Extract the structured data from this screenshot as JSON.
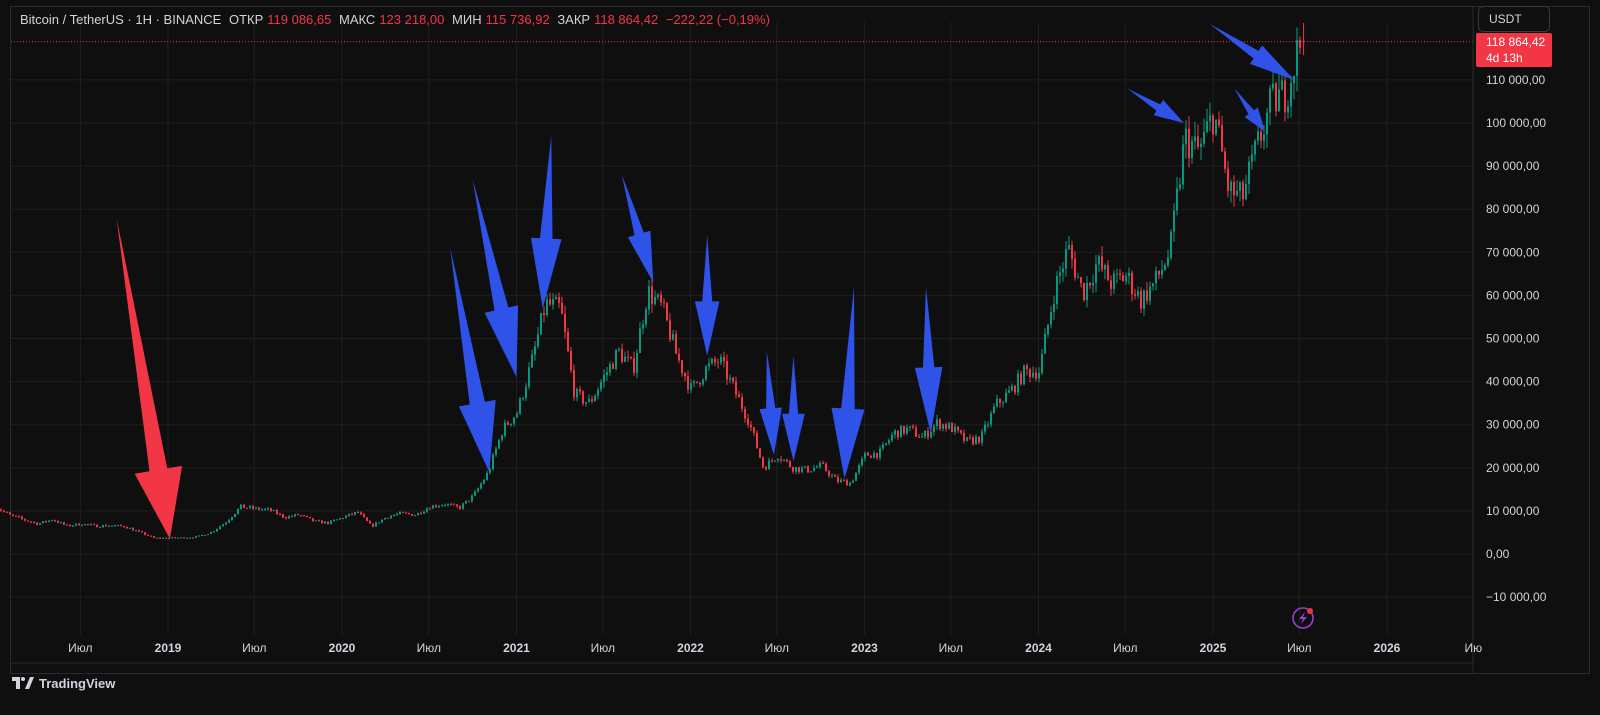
{
  "legend": {
    "symbol": "Bitcoin / TetherUS · 1H · BINANCE",
    "open_label": "ОТКР",
    "open_value": "119 086,65",
    "high_label": "МАКС",
    "high_value": "123 218,00",
    "low_label": "МИН",
    "low_value": "115 736,92",
    "close_label": "ЗАКР",
    "close_value": "118 864,42",
    "change": "−222,22 (−0,19%)"
  },
  "currency_button": "USDT",
  "price_tag": {
    "price": "118 864,42",
    "countdown": "4d 13h"
  },
  "branding": "TradingView",
  "colors": {
    "up": "#089981",
    "down": "#f23645",
    "blue_arrow": "#2f52e8",
    "red_arrow": "#f23645",
    "background": "#0f0f0f",
    "grid": "#1f1f1f"
  },
  "chart_data": {
    "type": "candlestick",
    "y_scale": "linear",
    "ylim": [
      -15000,
      128000
    ],
    "xlim": [
      "2018-01-01",
      "2026-07-31"
    ],
    "y_ticks": [
      {
        "value": -10000,
        "label": "−10 000,00"
      },
      {
        "value": 0,
        "label": "0,00"
      },
      {
        "value": 10000,
        "label": "10 000,00"
      },
      {
        "value": 20000,
        "label": "20 000,00"
      },
      {
        "value": 30000,
        "label": "30 000,00"
      },
      {
        "value": 40000,
        "label": "40 000,00"
      },
      {
        "value": 50000,
        "label": "50 000,00"
      },
      {
        "value": 60000,
        "label": "60 000,00"
      },
      {
        "value": 70000,
        "label": "70 000,00"
      },
      {
        "value": 80000,
        "label": "80 000,00"
      },
      {
        "value": 90000,
        "label": "90 000,00"
      },
      {
        "value": 100000,
        "label": "100 000,00"
      },
      {
        "value": 110000,
        "label": "110 000,00"
      }
    ],
    "x_ticks": [
      {
        "date": "2018-07-01",
        "label": "Июл",
        "bold": false
      },
      {
        "date": "2019-01-01",
        "label": "2019",
        "bold": true
      },
      {
        "date": "2019-07-01",
        "label": "Июл",
        "bold": false
      },
      {
        "date": "2020-01-01",
        "label": "2020",
        "bold": true
      },
      {
        "date": "2020-07-01",
        "label": "Июл",
        "bold": false
      },
      {
        "date": "2021-01-01",
        "label": "2021",
        "bold": true
      },
      {
        "date": "2021-07-01",
        "label": "Июл",
        "bold": false
      },
      {
        "date": "2022-01-01",
        "label": "2022",
        "bold": true
      },
      {
        "date": "2022-07-01",
        "label": "Июл",
        "bold": false
      },
      {
        "date": "2023-01-01",
        "label": "2023",
        "bold": true
      },
      {
        "date": "2023-07-01",
        "label": "Июл",
        "bold": false
      },
      {
        "date": "2024-01-01",
        "label": "2024",
        "bold": true
      },
      {
        "date": "2024-07-01",
        "label": "Июл",
        "bold": false
      },
      {
        "date": "2025-01-01",
        "label": "2025",
        "bold": true
      },
      {
        "date": "2025-07-01",
        "label": "Июл",
        "bold": false
      },
      {
        "date": "2026-01-01",
        "label": "2026",
        "bold": true
      },
      {
        "date": "2026-07-01",
        "label": "Ию",
        "bold": false
      }
    ],
    "last_price": 118864.42,
    "price_series": {
      "name": "BTCUSDT",
      "points": [
        [
          "2018-01-01",
          11000
        ],
        [
          "2018-02-01",
          9000
        ],
        [
          "2018-03-01",
          8000
        ],
        [
          "2018-04-01",
          7000
        ],
        [
          "2018-05-01",
          8000
        ],
        [
          "2018-06-01",
          6500
        ],
        [
          "2018-07-01",
          7000
        ],
        [
          "2018-08-01",
          6500
        ],
        [
          "2018-09-01",
          6600
        ],
        [
          "2018-10-01",
          6400
        ],
        [
          "2018-11-01",
          5000
        ],
        [
          "2018-12-01",
          3700
        ],
        [
          "2019-01-01",
          3700
        ],
        [
          "2019-02-01",
          3800
        ],
        [
          "2019-03-01",
          4000
        ],
        [
          "2019-04-01",
          5100
        ],
        [
          "2019-05-01",
          7500
        ],
        [
          "2019-06-01",
          11000
        ],
        [
          "2019-07-01",
          10500
        ],
        [
          "2019-08-01",
          10200
        ],
        [
          "2019-09-01",
          8500
        ],
        [
          "2019-10-01",
          9100
        ],
        [
          "2019-11-01",
          7600
        ],
        [
          "2019-12-01",
          7200
        ],
        [
          "2020-01-01",
          8500
        ],
        [
          "2020-02-01",
          9700
        ],
        [
          "2020-03-01",
          6400
        ],
        [
          "2020-04-01",
          8600
        ],
        [
          "2020-05-01",
          9400
        ],
        [
          "2020-06-01",
          9100
        ],
        [
          "2020-07-01",
          11000
        ],
        [
          "2020-08-01",
          11600
        ],
        [
          "2020-09-01",
          10700
        ],
        [
          "2020-10-01",
          13500
        ],
        [
          "2020-11-01",
          19000
        ],
        [
          "2020-12-01",
          28900
        ],
        [
          "2021-01-01",
          33000
        ],
        [
          "2021-02-01",
          45000
        ],
        [
          "2021-03-01",
          58000
        ],
        [
          "2021-04-01",
          57000
        ],
        [
          "2021-05-01",
          37000
        ],
        [
          "2021-06-01",
          35000
        ],
        [
          "2021-07-01",
          41000
        ],
        [
          "2021-08-01",
          47000
        ],
        [
          "2021-09-01",
          43000
        ],
        [
          "2021-10-01",
          61000
        ],
        [
          "2021-11-01",
          57000
        ],
        [
          "2021-12-01",
          46000
        ],
        [
          "2022-01-01",
          38000
        ],
        [
          "2022-02-01",
          43000
        ],
        [
          "2022-03-01",
          45000
        ],
        [
          "2022-04-01",
          38000
        ],
        [
          "2022-05-01",
          31000
        ],
        [
          "2022-06-01",
          20000
        ],
        [
          "2022-07-01",
          23000
        ],
        [
          "2022-08-01",
          20000
        ],
        [
          "2022-09-01",
          19500
        ],
        [
          "2022-10-01",
          20500
        ],
        [
          "2022-11-01",
          17000
        ],
        [
          "2022-12-01",
          16500
        ],
        [
          "2023-01-01",
          23000
        ],
        [
          "2023-02-01",
          23500
        ],
        [
          "2023-03-01",
          28000
        ],
        [
          "2023-04-01",
          29000
        ],
        [
          "2023-05-01",
          27000
        ],
        [
          "2023-06-01",
          30500
        ],
        [
          "2023-07-01",
          29200
        ],
        [
          "2023-08-01",
          26000
        ],
        [
          "2023-09-01",
          27000
        ],
        [
          "2023-10-01",
          34500
        ],
        [
          "2023-11-01",
          37700
        ],
        [
          "2023-12-01",
          42300
        ],
        [
          "2024-01-01",
          42500
        ],
        [
          "2024-02-01",
          61000
        ],
        [
          "2024-03-01",
          71000
        ],
        [
          "2024-04-01",
          60600
        ],
        [
          "2024-05-01",
          67500
        ],
        [
          "2024-06-01",
          62700
        ],
        [
          "2024-07-01",
          64600
        ],
        [
          "2024-08-01",
          58900
        ],
        [
          "2024-09-01",
          63300
        ],
        [
          "2024-10-01",
          70200
        ],
        [
          "2024-11-01",
          96400
        ],
        [
          "2024-12-01",
          93400
        ],
        [
          "2025-01-01",
          102400
        ],
        [
          "2025-02-01",
          84300
        ],
        [
          "2025-03-01",
          82500
        ],
        [
          "2025-04-01",
          94200
        ],
        [
          "2025-05-01",
          104600
        ],
        [
          "2025-06-01",
          107100
        ],
        [
          "2025-07-01",
          118864
        ]
      ]
    },
    "annotations": [
      {
        "type": "arrow",
        "color": "red",
        "from": [
          "2018-09-15",
          78000
        ],
        "to": [
          "2019-01-05",
          3500
        ]
      },
      {
        "type": "arrow",
        "color": "blue",
        "from": [
          "2020-08-15",
          71000
        ],
        "to": [
          "2020-11-05",
          19000
        ]
      },
      {
        "type": "arrow",
        "color": "blue",
        "from": [
          "2020-10-01",
          87000
        ],
        "to": [
          "2021-01-01",
          41000
        ]
      },
      {
        "type": "arrow",
        "color": "blue",
        "from": [
          "2021-03-15",
          97000
        ],
        "to": [
          "2021-02-25",
          57000
        ]
      },
      {
        "type": "arrow",
        "color": "blue",
        "from": [
          "2021-08-10",
          88000
        ],
        "to": [
          "2021-10-15",
          63000
        ]
      },
      {
        "type": "arrow",
        "color": "blue",
        "from": [
          "2022-02-05",
          74000
        ],
        "to": [
          "2022-02-05",
          46000
        ]
      },
      {
        "type": "arrow",
        "color": "blue",
        "from": [
          "2022-06-10",
          47000
        ],
        "to": [
          "2022-06-25",
          23000
        ]
      },
      {
        "type": "arrow",
        "color": "blue",
        "from": [
          "2022-08-05",
          46000
        ],
        "to": [
          "2022-08-05",
          21500
        ]
      },
      {
        "type": "arrow",
        "color": "blue",
        "from": [
          "2022-12-10",
          62000
        ],
        "to": [
          "2022-11-20",
          17500
        ]
      },
      {
        "type": "arrow",
        "color": "blue",
        "from": [
          "2023-05-10",
          62000
        ],
        "to": [
          "2023-05-20",
          28000
        ]
      },
      {
        "type": "arrow",
        "color": "blue",
        "from": [
          "2024-07-05",
          108000
        ],
        "to": [
          "2024-11-01",
          100000
        ]
      },
      {
        "type": "arrow",
        "color": "blue",
        "from": [
          "2025-02-15",
          108000
        ],
        "to": [
          "2025-04-20",
          98000
        ]
      },
      {
        "type": "arrow",
        "color": "blue",
        "from": [
          "2024-12-25",
          123000
        ],
        "to": [
          "2025-06-20",
          110000
        ]
      }
    ]
  }
}
